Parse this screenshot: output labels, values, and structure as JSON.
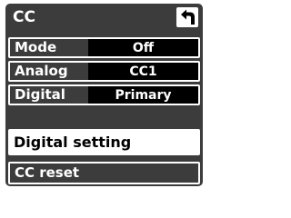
{
  "screen": {
    "title": "CC",
    "back_icon": "back-arrow-icon"
  },
  "settings": [
    {
      "label": "Mode",
      "value": "Off"
    },
    {
      "label": "Analog",
      "value": "CC1"
    },
    {
      "label": "Digital",
      "value": "Primary"
    }
  ],
  "buttons": {
    "digital_setting": "Digital setting",
    "cc_reset": "CC reset"
  },
  "colors": {
    "panel": "#3c3c3c",
    "value_field": "#000000",
    "text_light": "#ffffff",
    "highlight": "#ffffff"
  }
}
